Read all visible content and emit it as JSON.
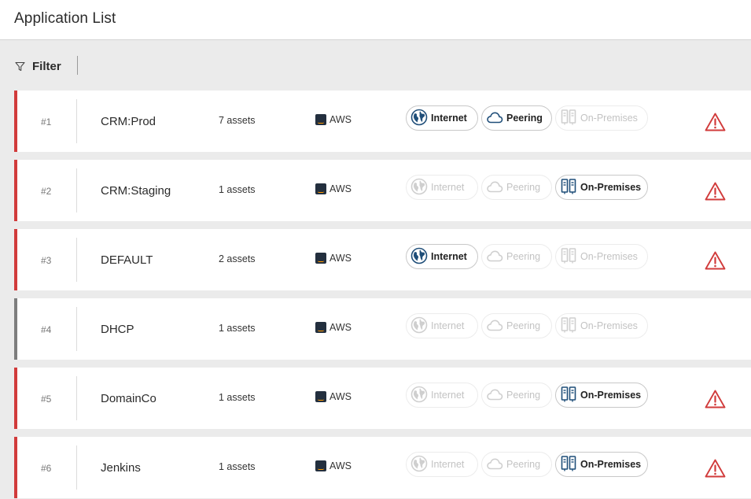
{
  "header": {
    "title": "Application List"
  },
  "filter": {
    "label": "Filter",
    "icon": "filter-icon"
  },
  "colors": {
    "alert": "#d13b3b",
    "neutral": "#7d7d7d",
    "active_icon": "#1f4e79"
  },
  "pill_labels": {
    "internet": "Internet",
    "peering": "Peering",
    "on_premises": "On-Premises"
  },
  "applications": [
    {
      "index": "#1",
      "name": "CRM:Prod",
      "assets": "7 assets",
      "cloud": "AWS",
      "internet": true,
      "peering": true,
      "on_premises": false,
      "alert": true
    },
    {
      "index": "#2",
      "name": "CRM:Staging",
      "assets": "1 assets",
      "cloud": "AWS",
      "internet": false,
      "peering": false,
      "on_premises": true,
      "alert": true
    },
    {
      "index": "#3",
      "name": "DEFAULT",
      "assets": "2 assets",
      "cloud": "AWS",
      "internet": true,
      "peering": false,
      "on_premises": false,
      "alert": true
    },
    {
      "index": "#4",
      "name": "DHCP",
      "assets": "1 assets",
      "cloud": "AWS",
      "internet": false,
      "peering": false,
      "on_premises": false,
      "alert": false
    },
    {
      "index": "#5",
      "name": "DomainCo",
      "assets": "1 assets",
      "cloud": "AWS",
      "internet": false,
      "peering": false,
      "on_premises": true,
      "alert": true
    },
    {
      "index": "#6",
      "name": "Jenkins",
      "assets": "1 assets",
      "cloud": "AWS",
      "internet": false,
      "peering": false,
      "on_premises": true,
      "alert": true
    }
  ]
}
